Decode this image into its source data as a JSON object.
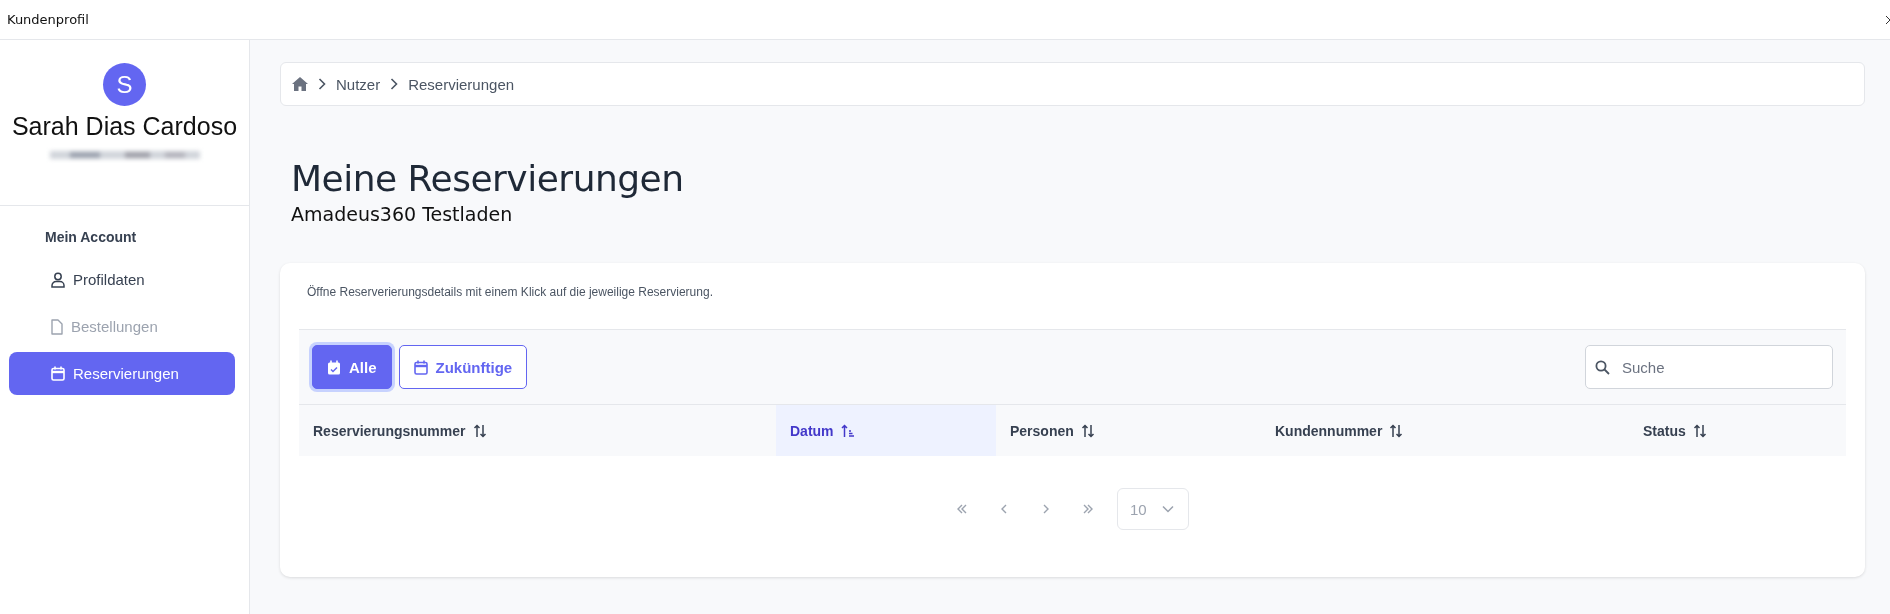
{
  "window": {
    "title": "Kundenprofil"
  },
  "sidebar": {
    "avatar_initial": "S",
    "name": "Sarah Dias Cardoso",
    "section_title": "Mein Account",
    "items": [
      {
        "label": "Profildaten",
        "kind": "user",
        "selected": false,
        "disabled": false
      },
      {
        "label": "Bestellungen",
        "kind": "document",
        "selected": false,
        "disabled": true
      },
      {
        "label": "Reservierungen",
        "kind": "calendar",
        "selected": true,
        "disabled": false
      }
    ]
  },
  "breadcrumb": [
    "Nutzer",
    "Reservierungen"
  ],
  "page": {
    "title": "Meine Reservierungen",
    "subtitle": "Amadeus360 Testladen"
  },
  "card": {
    "description": "Öffne Reserverierungsdetails mit einem Klick auf die jeweilige Reservierung.",
    "filters": [
      {
        "label": "Alle",
        "kind": "calendar-check",
        "selected": true
      },
      {
        "label": "Zukünftige",
        "kind": "calendar",
        "selected": false
      }
    ],
    "search": {
      "placeholder": "Suche"
    },
    "table": {
      "columns": [
        {
          "label": "Reservierungsnummer",
          "sorted": false
        },
        {
          "label": "Datum",
          "sorted": true
        },
        {
          "label": "Personen",
          "sorted": false
        },
        {
          "label": "Kundennummer",
          "sorted": false
        },
        {
          "label": "Status",
          "sorted": false
        }
      ]
    },
    "pagination": {
      "disabled": true,
      "page_size": "10"
    }
  }
}
